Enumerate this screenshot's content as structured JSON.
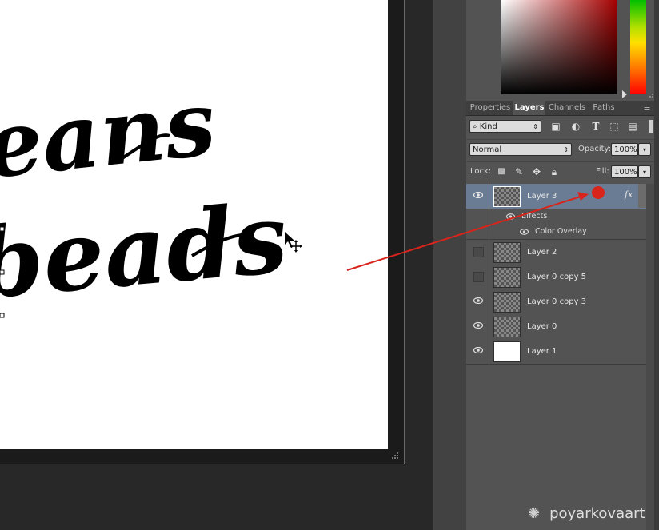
{
  "canvas": {
    "lettering_line1": "eans",
    "lettering_line2": "beads"
  },
  "panel_tabs": [
    "Properties",
    "Layers",
    "Channels",
    "Paths"
  ],
  "filter": {
    "kind_label": "Kind"
  },
  "blend": {
    "mode": "Normal",
    "opacity_label": "Opacity:",
    "opacity_value": "100%"
  },
  "lock": {
    "label": "Lock:",
    "fill_label": "Fill:",
    "fill_value": "100%"
  },
  "layers": [
    {
      "name": "Layer 3",
      "visible": true,
      "selected": true,
      "fx": "fx"
    },
    {
      "name": "Layer 2",
      "visible": false
    },
    {
      "name": "Layer 0 copy 5",
      "visible": false
    },
    {
      "name": "Layer 0 copy 3",
      "visible": true
    },
    {
      "name": "Layer 0",
      "visible": true
    },
    {
      "name": "Layer 1",
      "visible": true
    }
  ],
  "effects": {
    "header": "Effects",
    "items": [
      "Color Overlay"
    ]
  },
  "watermark": "poyarkovaart",
  "colors": {
    "annotation_red": "#d9241c",
    "selection_blue": "#6a7c93",
    "panel_bg": "#535353"
  }
}
